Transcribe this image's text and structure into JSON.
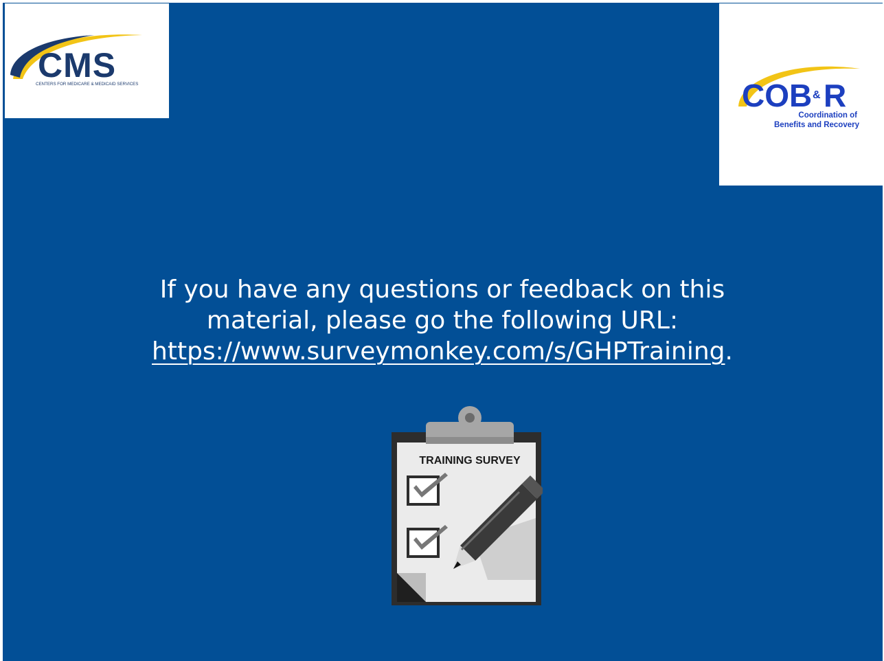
{
  "logos": {
    "cms": {
      "wordmark": "CMS",
      "tagline": "CENTERS FOR MEDICARE & MEDICAID SERVICES"
    },
    "cobr": {
      "wordmark": "COB&R",
      "subtitle_line1": "Coordination of",
      "subtitle_line2": "Benefits and Recovery"
    }
  },
  "message": {
    "line1": "If you have any questions or feedback on this",
    "line2": "material, please go the following URL:",
    "url": "https://www.surveymonkey.com/s/GHPTraining",
    "trailing": "."
  },
  "illustration": {
    "icon": "clipboard-survey-icon",
    "label": "TRAINING SURVEY"
  },
  "colors": {
    "background": "#024f96",
    "text": "#ffffff",
    "cms_navy": "#1b3a6d",
    "cms_gold": "#f2c416",
    "cobr_blue": "#1c3fbf",
    "cobr_gold": "#f2c416"
  }
}
